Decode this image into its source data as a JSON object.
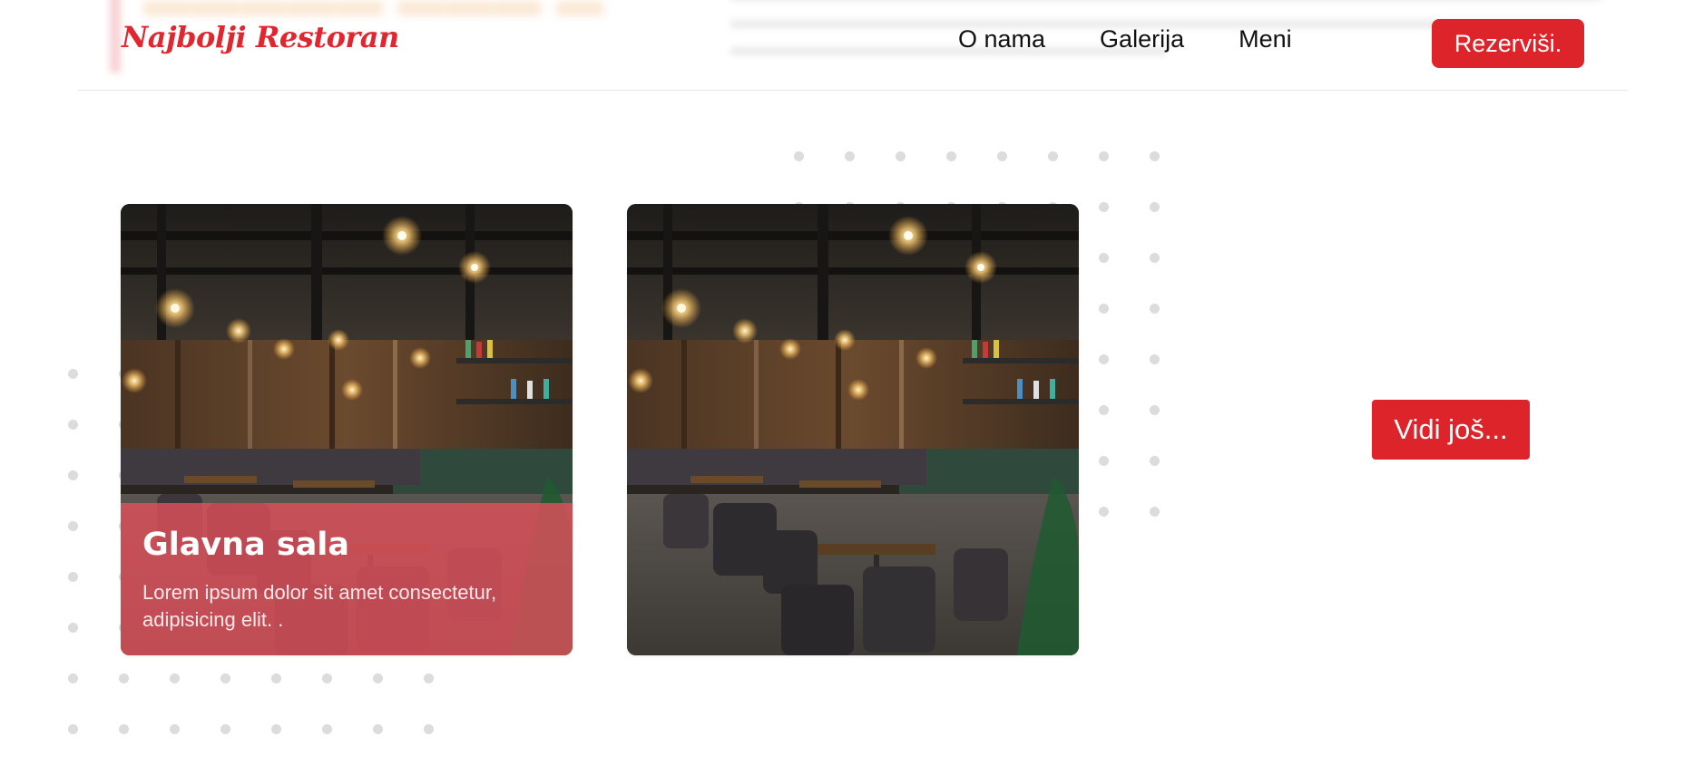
{
  "header": {
    "logo": "Najbolji Restoran",
    "nav": [
      {
        "label": "O nama"
      },
      {
        "label": "Galerija"
      },
      {
        "label": "Meni"
      }
    ],
    "reserve_button": "Rezerviši."
  },
  "gallery": {
    "cards": [
      {
        "title": "Glavna sala",
        "description": "Lorem ipsum dolor sit amet consectetur, adipisicing elit. .",
        "image": "restaurant-interior-photo"
      },
      {
        "image": "restaurant-interior-photo"
      }
    ],
    "more_button": "Vidi još..."
  },
  "colors": {
    "accent": "#dd242a",
    "overlay": "#de505c",
    "dots": "#dcdcdc"
  }
}
